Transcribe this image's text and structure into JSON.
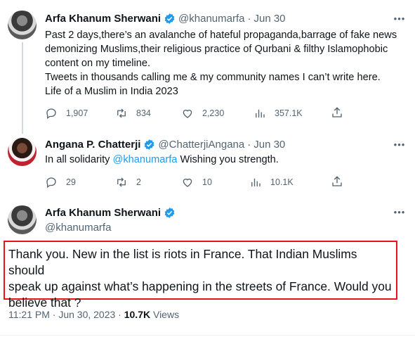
{
  "tweets": [
    {
      "name": "Arfa Khanum Sherwani",
      "handle": "@khanumarfa",
      "date": "Jun 30",
      "lines": [
        "Past 2 days,there’s an avalanche of hateful propaganda,barrage of fake news",
        "demonizing Muslims,their religious practice of Qurbani & filthy Islamophobic",
        "content on my timeline.",
        "Tweets in thousands calling me & my community names I can’t write here.",
        "Life of a Muslim in India 2023"
      ],
      "replies": "1,907",
      "retweets": "834",
      "likes": "2,230",
      "views": "357.1K"
    },
    {
      "name": "Angana P. Chatterji",
      "handle": "@ChatterjiAngana",
      "date": "Jun 30",
      "text_before": "In all solidarity ",
      "mention": "@khanumarfa",
      "text_after": " Wishing you strength.",
      "replies": "29",
      "retweets": "2",
      "likes": "10",
      "views": "10.1K"
    }
  ],
  "main_tweet": {
    "name": "Arfa Khanum Sherwani",
    "handle": "@khanumarfa",
    "lines": [
      "Thank you. New in the list is riots in France. That Indian Muslims should",
      "speak up against what’s happening in the streets of France. Would you",
      "believe that ?"
    ],
    "time": "11:21 PM · Jun 30, 2023 · ",
    "views_count": "10.7K",
    "views_label": " Views"
  },
  "colors": {
    "accent": "#1d9bf0",
    "secondary_text": "#536471",
    "highlight_border": "#e8141a"
  },
  "icons": [
    "verified-badge-icon",
    "more-icon",
    "reply-icon",
    "retweet-icon",
    "like-icon",
    "views-icon",
    "share-icon"
  ]
}
